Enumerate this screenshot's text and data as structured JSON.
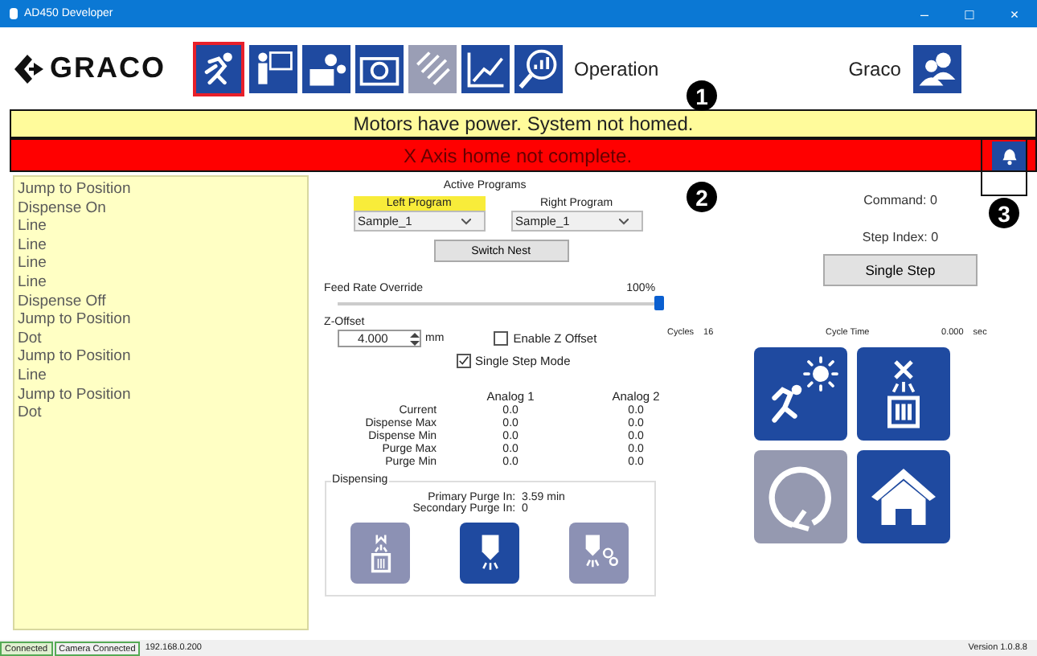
{
  "window": {
    "title": "AD450 Developer",
    "controls": [
      "–",
      "□",
      "×"
    ]
  },
  "toolbar": {
    "logo": "GRACO",
    "buttons": [
      {
        "kind": "operation",
        "selected": true,
        "disabled": false
      },
      {
        "kind": "teach",
        "selected": false,
        "disabled": false
      },
      {
        "kind": "setup",
        "selected": false,
        "disabled": false
      },
      {
        "kind": "camera",
        "selected": false,
        "disabled": false
      },
      {
        "kind": "barcode",
        "selected": false,
        "disabled": true
      },
      {
        "kind": "chart",
        "selected": false,
        "disabled": false
      },
      {
        "kind": "inspect",
        "selected": false,
        "disabled": false
      }
    ],
    "page_title": "Operation",
    "user": "Graco"
  },
  "status_message": "Motors have power. System not homed.",
  "alarm_message": "X Axis home not complete.",
  "callouts": [
    "1",
    "2",
    "3"
  ],
  "program_steps": [
    "Jump to Position",
    "Dispense On",
    "Line",
    "Line",
    "Line",
    "Line",
    "Dispense Off",
    "Jump to Position",
    "Dot",
    "Jump to Position",
    "Line",
    "Jump to Position",
    "Dot"
  ],
  "active_programs": {
    "title": "Active Programs",
    "programs": [
      {
        "label": "Left Program",
        "selected": true,
        "value": "Sample_1"
      },
      {
        "label": "Right Program",
        "selected": false,
        "value": "Sample_1"
      }
    ],
    "switch_button": "Switch Nest"
  },
  "feed_rate": {
    "label": "Feed Rate Override",
    "reading": "100%",
    "level": 1.0
  },
  "z_offset": {
    "label": "Z-Offset",
    "value": "4.000",
    "unit": "mm",
    "enable_label": "Enable Z Offset",
    "enable_checked": false
  },
  "single_step_mode": {
    "label": "Single Step Mode",
    "checked": true
  },
  "analog": {
    "columns": [
      "Analog 1",
      "Analog 2"
    ],
    "rows": [
      {
        "label": "Current",
        "values": [
          "0.0",
          "0.0"
        ]
      },
      {
        "label": "Dispense Max",
        "values": [
          "0.0",
          "0.0"
        ]
      },
      {
        "label": "Dispense Min",
        "values": [
          "0.0",
          "0.0"
        ]
      },
      {
        "label": "Purge Max",
        "values": [
          "0.0",
          "0.0"
        ]
      },
      {
        "label": "Purge Min",
        "values": [
          "0.0",
          "0.0"
        ]
      }
    ]
  },
  "dispensing": {
    "title": "Dispensing",
    "primary_label": "Primary Purge In:",
    "primary_value": "3.59 min",
    "secondary_label": "Secondary Purge In:",
    "secondary_value": "0",
    "buttons": [
      {
        "kind": "manual-purge",
        "disabled": true
      },
      {
        "kind": "dispense",
        "disabled": false
      },
      {
        "kind": "dispense-setup",
        "disabled": true
      }
    ]
  },
  "command": "Command: 0",
  "step_index": "Step Index: 0",
  "single_step_button": "Single Step",
  "cycles": {
    "label": "Cycles",
    "value": "16",
    "time_label": "Cycle Time",
    "time_value": "0.000",
    "time_unit": "sec"
  },
  "actions": [
    {
      "kind": "start",
      "disabled": false
    },
    {
      "kind": "purge",
      "disabled": false
    },
    {
      "kind": "cycle",
      "disabled": true
    },
    {
      "kind": "home",
      "disabled": false
    }
  ],
  "status_bar": {
    "connection": "Connected",
    "camera": "Camera Connected",
    "address": "192.168.0.200",
    "version": "Version 1.0.8.8"
  }
}
